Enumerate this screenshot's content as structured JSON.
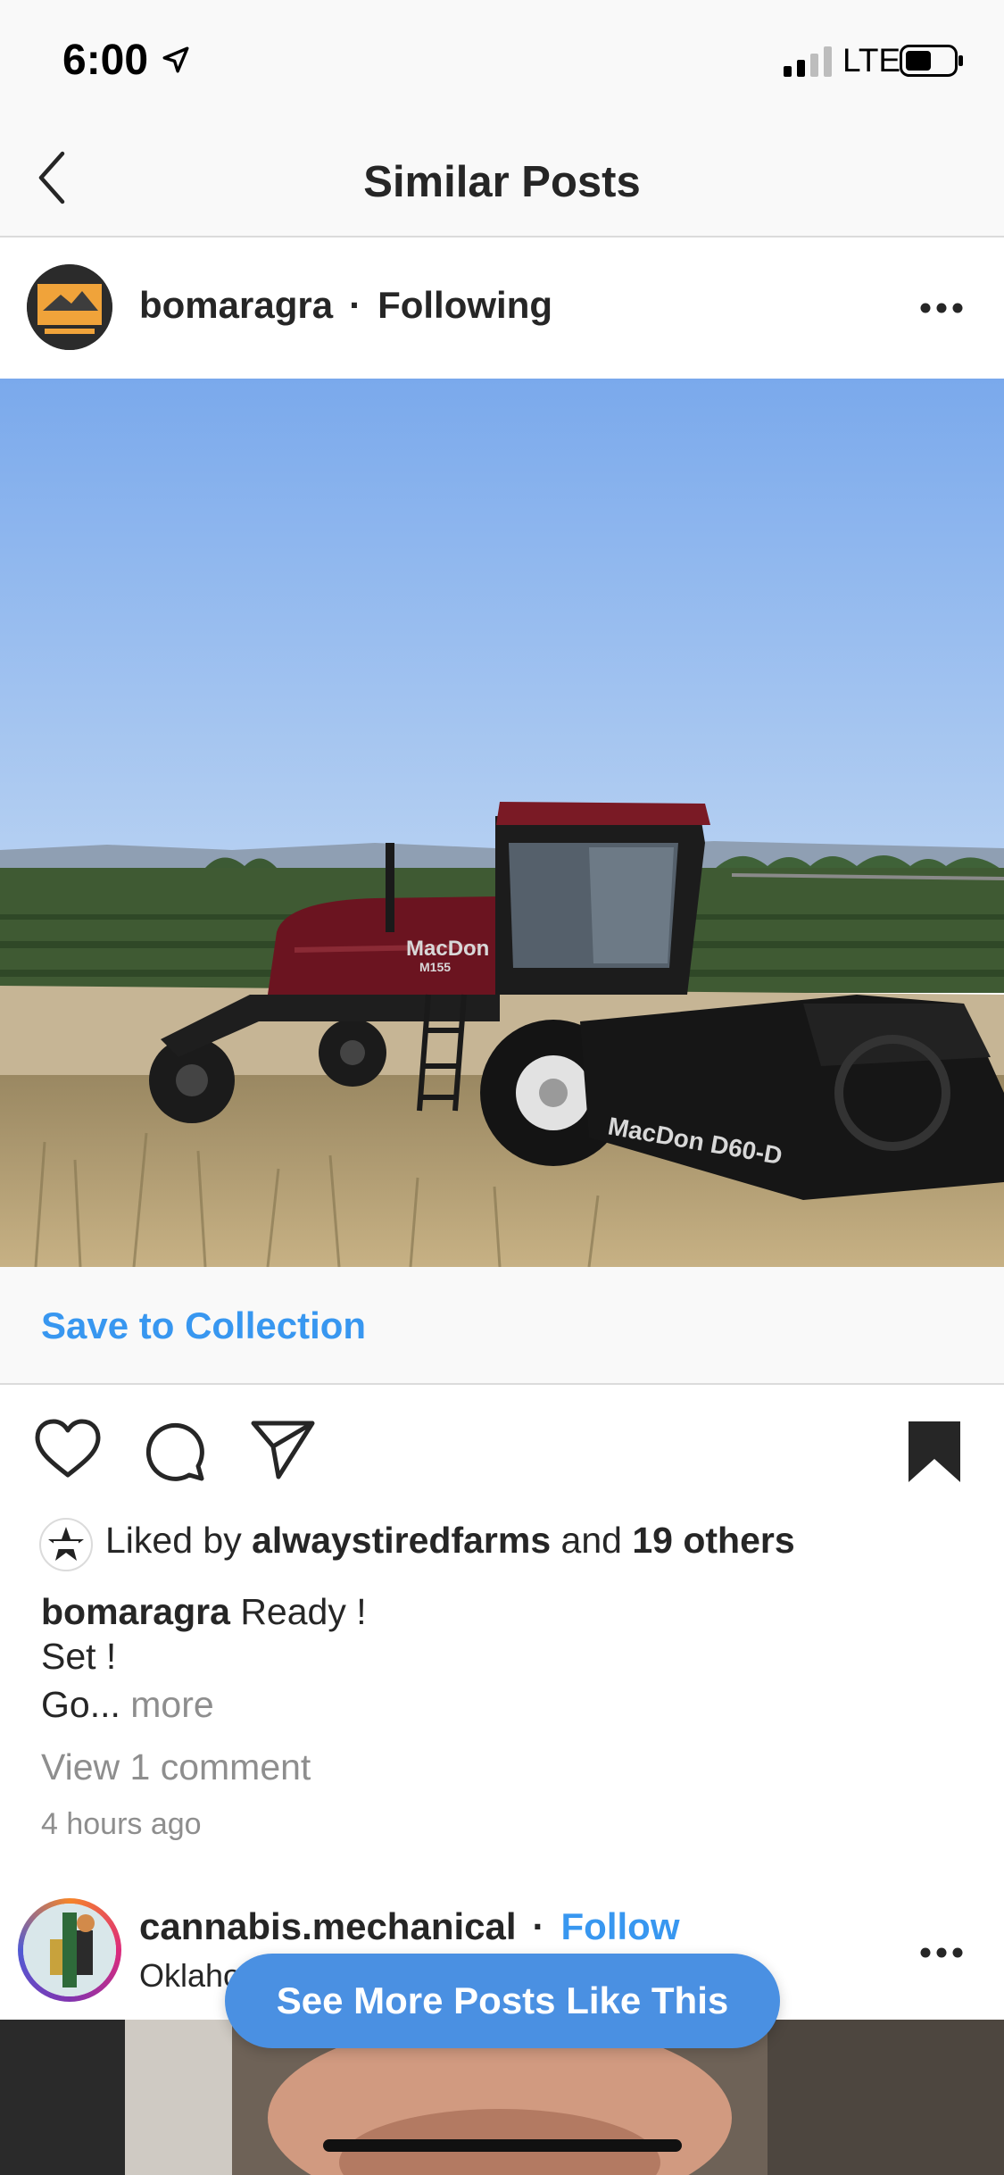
{
  "status_bar": {
    "time": "6:00",
    "carrier": "LTE",
    "icons": [
      "location-arrow-icon",
      "signal-icon",
      "battery-icon"
    ]
  },
  "nav": {
    "title": "Similar Posts",
    "back_icon": "chevron-left-icon"
  },
  "post1": {
    "username": "bomaragra",
    "separator": "·",
    "follow_status": "Following",
    "save_to_collection": "Save to Collection",
    "likes": {
      "prefix": "Liked by ",
      "user": "alwaystiredfarms",
      "middle": " and ",
      "others": "19 others"
    },
    "caption_user": "bomaragra",
    "caption_lines": [
      " Ready !",
      "Set !",
      "Go..."
    ],
    "more": " more",
    "view_comments": "View 1 comment",
    "time_ago": "4 hours ago",
    "photo_text": {
      "brand": "MacDon",
      "model": "M155",
      "header": "MacDon D60-D"
    },
    "icons": [
      "heart-icon",
      "comment-icon",
      "share-icon",
      "bookmark-icon",
      "more-options-icon"
    ]
  },
  "post2": {
    "username": "cannabis.mechanical",
    "separator": "·",
    "follow_label": "Follow",
    "location": "Oklaho"
  },
  "floating_button": {
    "label": "See More Posts Like This"
  },
  "colors": {
    "link_blue": "#3897f0",
    "pill_blue": "#4a90e2",
    "text": "#262626",
    "muted": "#8e8e8e",
    "bar_bg": "#f9f9f9"
  }
}
